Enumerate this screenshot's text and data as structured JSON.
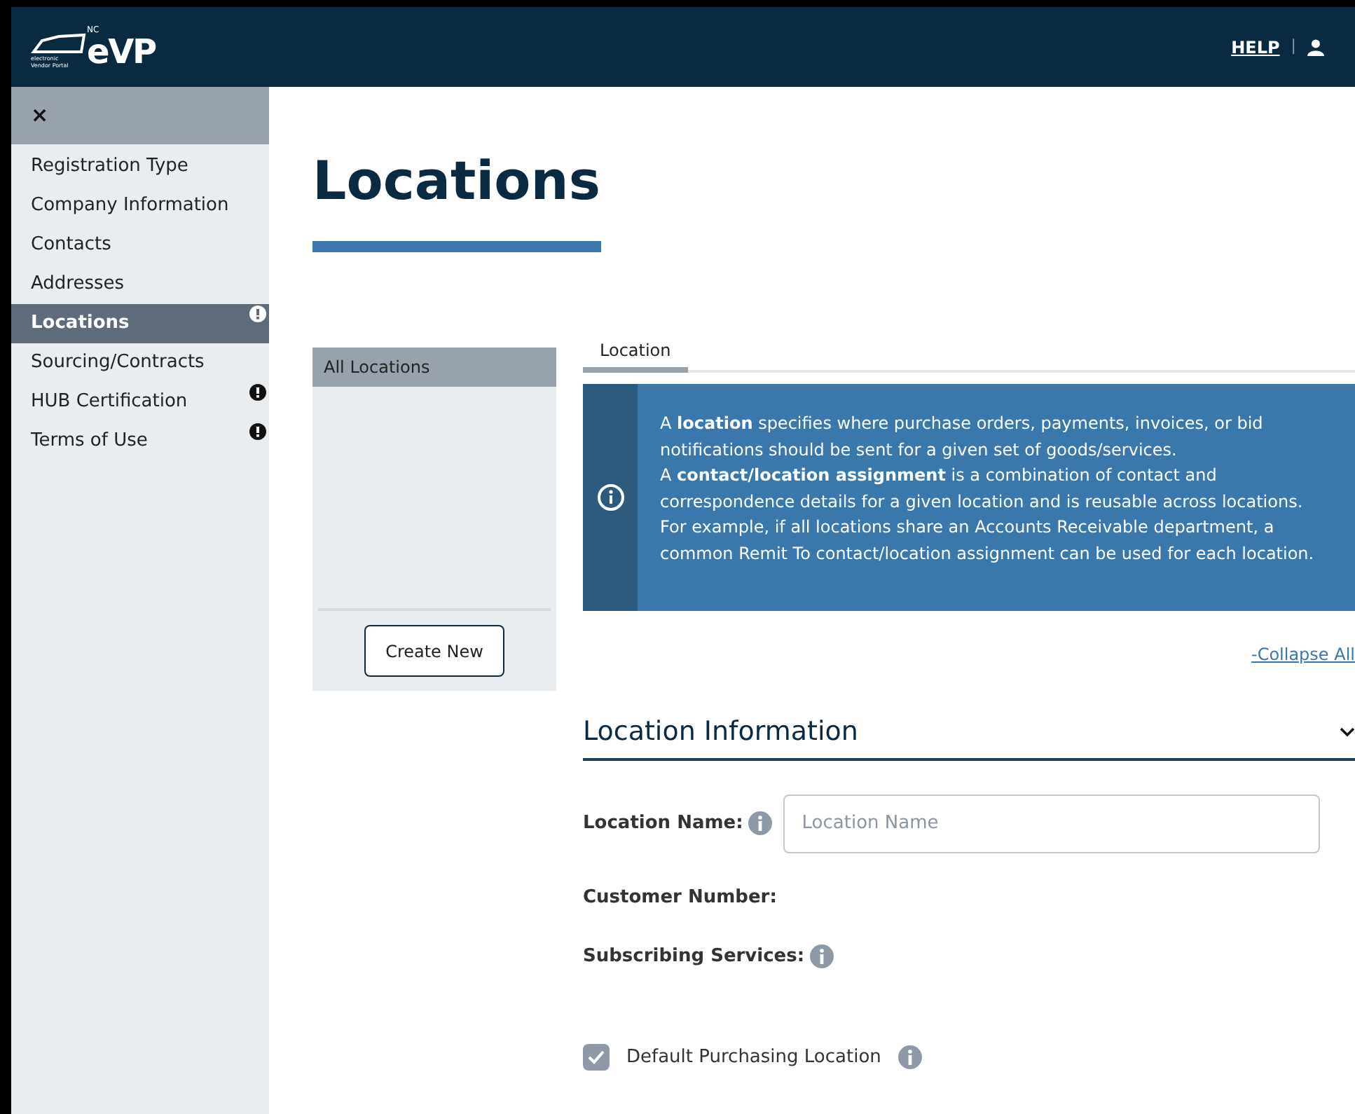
{
  "header": {
    "logo": {
      "badge": "NC",
      "mark": "eVP",
      "subtitle": "electronic Vendor Portal"
    },
    "help_link": "HELP",
    "separator": "|"
  },
  "sidebar": {
    "close": "×",
    "items": [
      {
        "label": "Registration Type",
        "selected": false,
        "alert": false
      },
      {
        "label": "Company Information",
        "selected": false,
        "alert": false
      },
      {
        "label": "Contacts",
        "selected": false,
        "alert": false
      },
      {
        "label": "Addresses",
        "selected": false,
        "alert": false
      },
      {
        "label": "Locations",
        "selected": true,
        "alert": true
      },
      {
        "label": "Sourcing/Contracts",
        "selected": false,
        "alert": false
      },
      {
        "label": "HUB Certification",
        "selected": false,
        "alert": true
      },
      {
        "label": "Terms of Use",
        "selected": false,
        "alert": true
      }
    ]
  },
  "page_title": "Locations",
  "locations_list": {
    "header": "All Locations",
    "create_button": "Create New"
  },
  "tabs": [
    {
      "label": "Location",
      "selected": true
    }
  ],
  "info": [
    "A **location** specifies where purchase orders, payments, invoices, or bid notifications should be sent for a given set of goods/services.",
    "A **contact/location assignment** is a combination of contact and correspondence details for a given location and is reusable across locations. For example, if all locations share an Accounts Receivable department, a common Remit To contact/location assignment can be used for each location."
  ],
  "collapse_link": "-Collapse All",
  "section": {
    "title": "Location Information",
    "expanded": true
  },
  "fields": [
    {
      "kind": "input",
      "label": "Location Name:",
      "info": true,
      "placeholder": "Location Name"
    },
    {
      "kind": "text",
      "label": "Customer Number:",
      "info": false
    },
    {
      "kind": "text",
      "label": "Subscribing Services:",
      "info": true
    },
    {
      "kind": "checkbox",
      "label": "Default Purchasing Location",
      "info": true,
      "checked": true
    }
  ]
}
